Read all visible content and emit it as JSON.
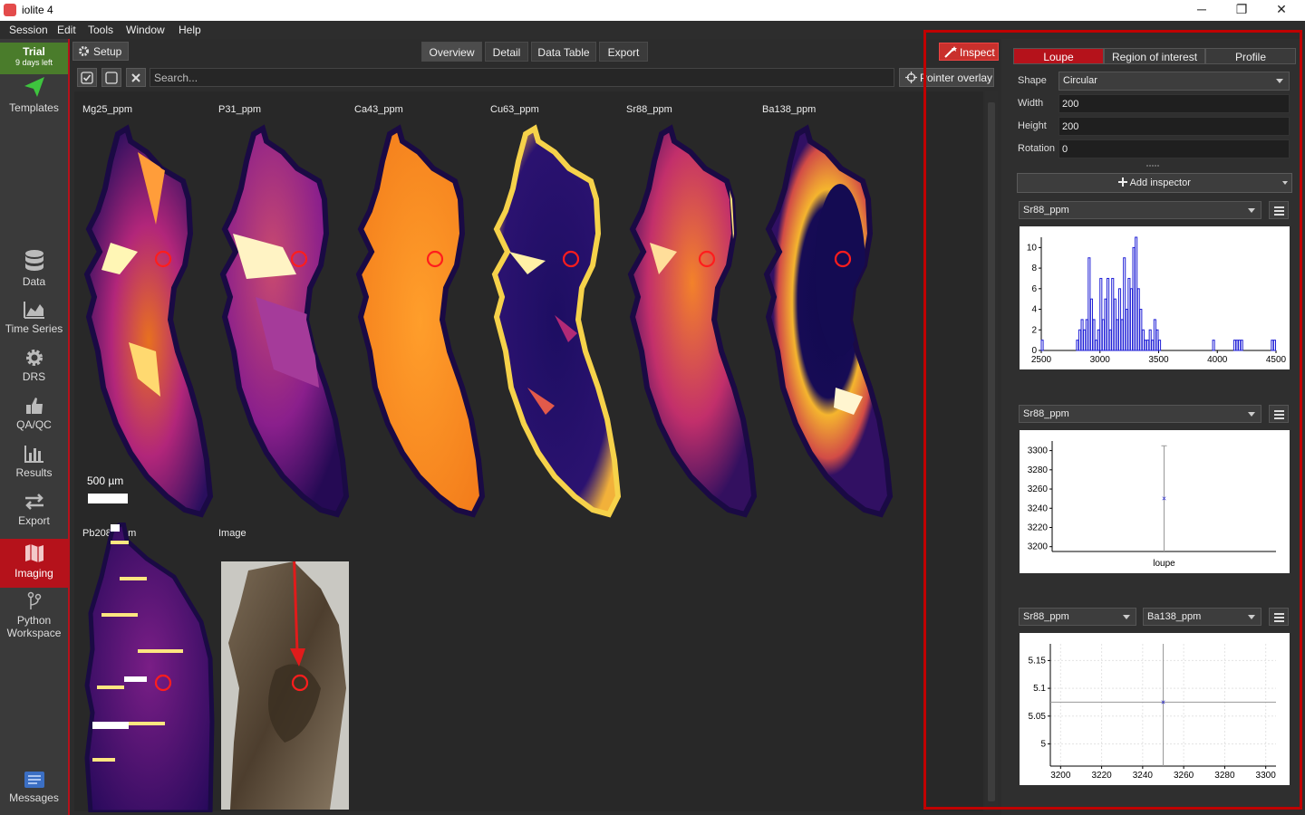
{
  "window": {
    "title": "iolite 4",
    "minimize": "─",
    "restore": "❐",
    "close": "✕"
  },
  "menu": [
    "Session",
    "Edit",
    "Tools",
    "Window",
    "Help"
  ],
  "trial": {
    "label": "Trial",
    "days": "9 days left"
  },
  "nav": [
    {
      "label": "Templates",
      "icon": "send-icon"
    },
    {
      "label": "Data",
      "icon": "database-icon"
    },
    {
      "label": "Time Series",
      "icon": "area-chart-icon"
    },
    {
      "label": "DRS",
      "icon": "gear-icon"
    },
    {
      "label": "QA/QC",
      "icon": "thumbs-up-icon"
    },
    {
      "label": "Results",
      "icon": "bar-chart-icon"
    },
    {
      "label": "Export",
      "icon": "exchange-icon"
    },
    {
      "label": "Imaging",
      "icon": "map-icon"
    },
    {
      "label": "Python Workspace",
      "icon": "branch-icon"
    },
    {
      "label": "Messages",
      "icon": "messages-icon"
    }
  ],
  "toolbar": {
    "setup": "Setup",
    "tabs": [
      "Overview",
      "Detail",
      "Data Table",
      "Export"
    ],
    "active_tab": "Overview"
  },
  "search": {
    "placeholder": "Search...",
    "pointer_overlay": "Pointer overlay"
  },
  "maps": {
    "labels": [
      "Mg25_ppm",
      "P31_ppm",
      "Ca43_ppm",
      "Cu63_ppm",
      "Sr88_ppm",
      "Ba138_ppm",
      "Pb208_ppm",
      "Image"
    ],
    "scale": "500 µm"
  },
  "inspect": {
    "button": "Inspect",
    "tabs": [
      "Loupe",
      "Region of interest",
      "Profile"
    ],
    "active_tab": "Loupe",
    "fields": [
      {
        "label": "Shape",
        "value": "Circular"
      },
      {
        "label": "Width",
        "value": "200"
      },
      {
        "label": "Height",
        "value": "200"
      },
      {
        "label": "Rotation",
        "value": "0"
      }
    ],
    "add_inspector": "Add inspector",
    "inspectors": [
      {
        "selects": [
          "Sr88_ppm"
        ]
      },
      {
        "selects": [
          "Sr88_ppm"
        ]
      },
      {
        "selects": [
          "Sr88_ppm",
          "Ba138_ppm"
        ]
      }
    ]
  },
  "chart_data": [
    {
      "type": "bar",
      "title": "",
      "xlabel": "",
      "ylabel": "",
      "xlim": [
        2500,
        4500
      ],
      "ylim": [
        0,
        11
      ],
      "xticks": [
        2500,
        3000,
        3500,
        4000,
        4500
      ],
      "yticks": [
        0,
        2,
        4,
        6,
        8,
        10
      ],
      "bin_width": 20,
      "x": [
        2500,
        2800,
        2820,
        2840,
        2860,
        2880,
        2900,
        2920,
        2940,
        2960,
        2980,
        3000,
        3020,
        3040,
        3060,
        3080,
        3100,
        3120,
        3140,
        3160,
        3180,
        3200,
        3220,
        3240,
        3260,
        3280,
        3300,
        3320,
        3340,
        3360,
        3380,
        3400,
        3420,
        3440,
        3460,
        3480,
        3500,
        3520,
        3540,
        3560,
        3580,
        3600,
        3620,
        3640,
        3660,
        3680,
        3700,
        3720,
        3740,
        3760,
        3780,
        3800,
        3820,
        3840,
        3860,
        3880,
        3900,
        3920,
        3940,
        3960,
        3980,
        4000,
        4020,
        4040,
        4060,
        4080,
        4100,
        4120,
        4140,
        4160,
        4180,
        4200,
        4220,
        4240,
        4260,
        4280,
        4300,
        4320,
        4340,
        4360,
        4380,
        4400,
        4420,
        4440,
        4460,
        4480
      ],
      "values": [
        1,
        1,
        2,
        3,
        2,
        3,
        9,
        5,
        3,
        1,
        2,
        7,
        3,
        5,
        7,
        2,
        7,
        5,
        3,
        6,
        3,
        9,
        4,
        7,
        6,
        10,
        11,
        6,
        4,
        2,
        1,
        1,
        2,
        1,
        3,
        2,
        1,
        0,
        0,
        0,
        0,
        0,
        0,
        0,
        0,
        0,
        0,
        0,
        0,
        0,
        0,
        0,
        0,
        0,
        0,
        0,
        0,
        0,
        0,
        1,
        0,
        0,
        0,
        0,
        0,
        0,
        0,
        0,
        1,
        1,
        1,
        1,
        0,
        0,
        0,
        0,
        0,
        0,
        0,
        0,
        0,
        0,
        0,
        0,
        1,
        1
      ]
    },
    {
      "type": "scatter",
      "title": "",
      "xlabel": "loupe",
      "ylabel": "",
      "ylim": [
        3195,
        3310
      ],
      "yticks": [
        3200,
        3220,
        3240,
        3260,
        3280,
        3300
      ],
      "category": "loupe",
      "mean": 3250,
      "err_low": 3195,
      "err_high": 3305
    },
    {
      "type": "scatter",
      "title": "",
      "xlabel": "",
      "ylabel": "",
      "xlim": [
        3195,
        3305
      ],
      "ylim": [
        4.96,
        5.18
      ],
      "xticks": [
        3200,
        3220,
        3240,
        3260,
        3280,
        3300
      ],
      "yticks": [
        5,
        5.05,
        5.1,
        5.15
      ],
      "x": 3250,
      "y": 5.075,
      "x_err": [
        3195,
        3305
      ],
      "y_err": [
        4.96,
        5.18
      ]
    }
  ]
}
